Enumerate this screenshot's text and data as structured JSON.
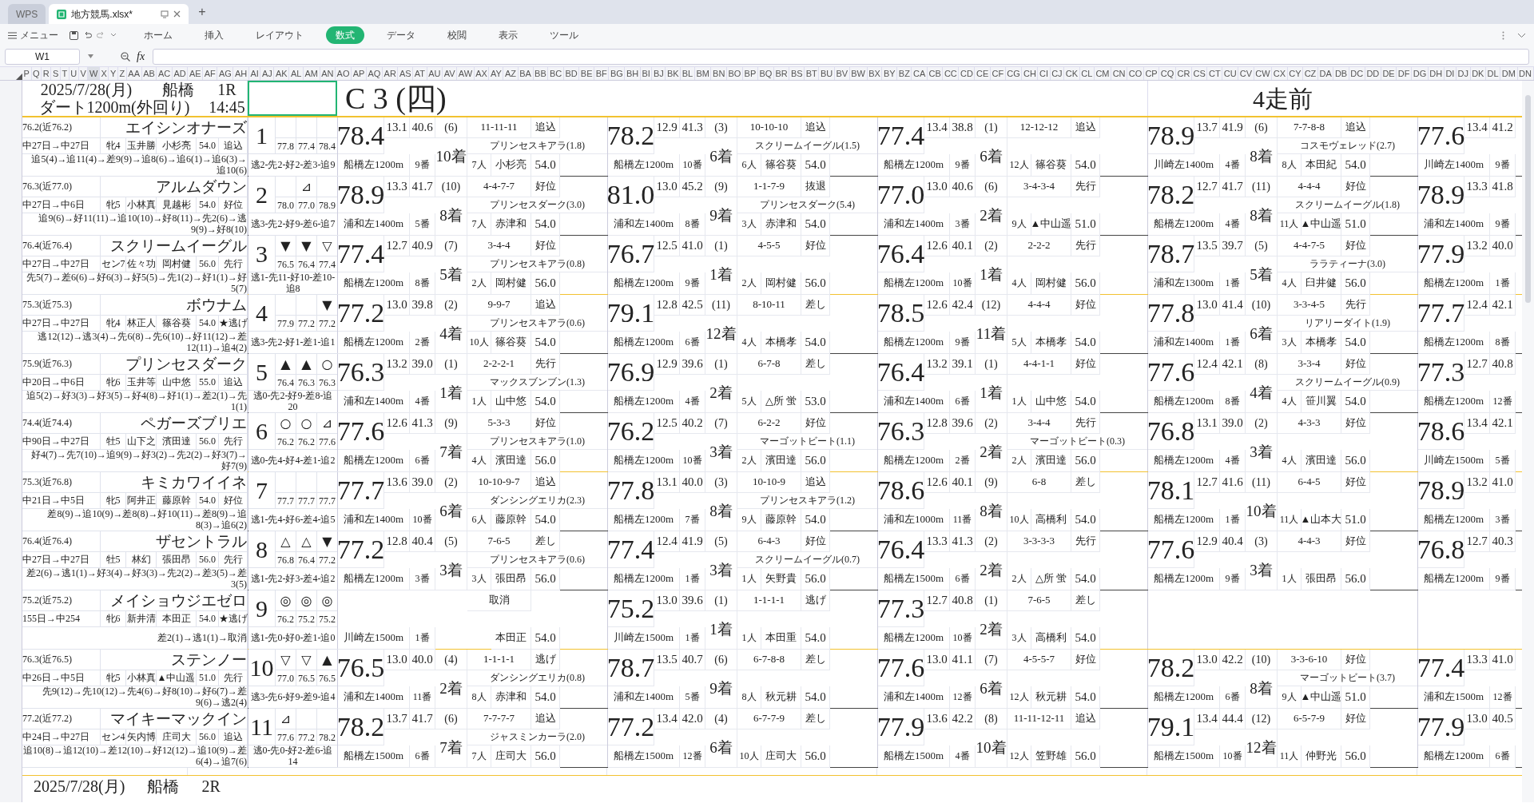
{
  "tabs": [
    {
      "label": "WPS",
      "selected": false
    },
    {
      "label": "地方競馬.xlsx*",
      "selected": true
    }
  ],
  "new_tab": "+",
  "menu": "メニュー",
  "ribbon_tabs": [
    {
      "label": "ホーム",
      "selected": false
    },
    {
      "label": "挿入",
      "selected": false
    },
    {
      "label": "レイアウト",
      "selected": false
    },
    {
      "label": "数式",
      "selected": true
    },
    {
      "label": "データ",
      "selected": false
    },
    {
      "label": "校閲",
      "selected": false
    },
    {
      "label": "表示",
      "selected": false
    },
    {
      "label": "ツール",
      "selected": false
    }
  ],
  "name_box": "W1",
  "formula_label": "fx",
  "columns": [
    "P",
    "Q",
    "R",
    "S",
    "T",
    "U",
    "V",
    "W",
    "X",
    "Y",
    "Z",
    "AA",
    "AB",
    "AC",
    "AD",
    "AE",
    "AF",
    "AG",
    "AH",
    "AI",
    "AJ",
    "AK",
    "AL",
    "AM",
    "AN",
    "AO",
    "AP",
    "AQ",
    "AR",
    "AS",
    "AT",
    "AU",
    "AV",
    "AW",
    "AX",
    "AY",
    "AZ",
    "BA",
    "BB",
    "BC",
    "BD",
    "BE",
    "BF",
    "BG",
    "BH",
    "BI",
    "BJ",
    "BK",
    "BL",
    "BM",
    "BN",
    "BO",
    "BP",
    "BQ",
    "BR",
    "BS",
    "BT",
    "BU",
    "BV",
    "BW",
    "BX",
    "BY",
    "BZ",
    "CA",
    "CB",
    "CC",
    "CD",
    "CE",
    "CF",
    "CG",
    "CH",
    "CI",
    "CJ",
    "CK",
    "CL",
    "CM",
    "CN",
    "CO",
    "CP",
    "CQ",
    "CR",
    "CS",
    "CT",
    "CU",
    "CV",
    "CW",
    "CX",
    "CY",
    "CZ",
    "DA",
    "DB",
    "DC",
    "DD",
    "DE",
    "DF",
    "DG",
    "DH",
    "DI",
    "DJ",
    "DK",
    "DL",
    "DM",
    "DN"
  ],
  "race": {
    "date": "2025/7/28(月)",
    "venue": "船橋",
    "number": "1R",
    "course": "ダート1200m(外回り)",
    "time": "14:45",
    "header_cells": [
      {
        "kind": "class",
        "text": "C 3 (四)"
      },
      {
        "kind": "runs",
        "text": "4走前"
      }
    ]
  },
  "horses": [
    {
      "rating": "76.2(近76.2)",
      "name": "エイシンオナーズ",
      "interval": "中27日→中27日",
      "sex": "牝4",
      "trainer": "玉井勝",
      "jockey": "小杉亮",
      "weight": "54.0",
      "style": "追込",
      "history": "追5(4)→追11(4)→差9(9)→追8(6)→追6(1)→追6(3)→追10(6)",
      "number": "1",
      "marks": [
        {
          "kind": "blank"
        },
        {
          "kind": "blank"
        },
        {
          "kind": "blank"
        }
      ],
      "mark_values": [
        "77.8",
        "77.4",
        "78.4"
      ],
      "style_counts": "逃2-先2-好2-差3-追9",
      "past": [
        {
          "kind": "run",
          "score": "78.4",
          "f3": "13.1",
          "l3": "40.6",
          "pos": "(6)",
          "pass": "11-11-11",
          "style": "追込",
          "winner": "プリンセスキアラ(1.8)",
          "course": "船橋左1200m",
          "gate": "9番",
          "finish": "10着",
          "pop": "7人",
          "jockey": "小杉亮",
          "weight": "54.0"
        },
        {
          "kind": "run",
          "score": "78.2",
          "f3": "12.9",
          "l3": "41.3",
          "pos": "(3)",
          "pass": "10-10-10",
          "style": "追込",
          "winner": "スクリームイーグル(1.5)",
          "course": "船橋左1200m",
          "gate": "10番",
          "finish": "6着",
          "pop": "6人",
          "jockey": "篠谷葵",
          "weight": "54.0"
        },
        {
          "kind": "run",
          "score": "77.4",
          "f3": "13.4",
          "l3": "38.8",
          "pos": "(1)",
          "pass": "12-12-12",
          "style": "追込",
          "course": "船橋左1200m",
          "gate": "9番",
          "finish": "6着",
          "pop": "12人",
          "jockey": "篠谷葵",
          "weight": "54.0"
        },
        {
          "kind": "run",
          "score": "78.9",
          "f3": "13.7",
          "l3": "41.9",
          "pos": "(6)",
          "pass": "7-7-8-8",
          "style": "追込",
          "winner": "コスモヴェレッド(2.7)",
          "course": "川崎左1400m",
          "gate": "4番",
          "finish": "8着",
          "pop": "8人",
          "jockey": "本田紀",
          "weight": "54.0"
        },
        {
          "kind": "run",
          "score": "77.6",
          "f3": "13.4",
          "l3": "41.2",
          "course": "川崎左1400m",
          "gate": "9番"
        }
      ]
    },
    {
      "rating": "76.3(近77.0)",
      "name": "アルムダウン",
      "interval": "中27日→中6日",
      "sex": "牝5",
      "trainer": "小林真",
      "jockey": "見越彬",
      "weight": "54.0",
      "style": "好位",
      "history": "追9(6)→好11(11)→追10(10)→好8(11)→先2(6)→逃9(9)→好8(10)",
      "number": "2",
      "marks": [
        {
          "kind": "blank"
        },
        {
          "kind": "mark",
          "symbol": "⊿"
        },
        {
          "kind": "blank"
        }
      ],
      "mark_values": [
        "78.0",
        "77.0",
        "78.9"
      ],
      "style_counts": "逃3-先2-好9-差6-追7",
      "past": [
        {
          "kind": "run",
          "score": "78.9",
          "f3": "13.3",
          "l3": "41.7",
          "pos": "(10)",
          "pass": "4-4-7-7",
          "style": "好位",
          "winner": "プリンセスダーク(3.0)",
          "course": "浦和左1400m",
          "gate": "5番",
          "finish": "8着",
          "pop": "7人",
          "jockey": "赤津和",
          "weight": "54.0"
        },
        {
          "kind": "run",
          "score": "81.0",
          "f3": "13.0",
          "l3": "45.2",
          "pos": "(9)",
          "pass": "1-1-7-9",
          "style": "抜退",
          "winner": "プリンセスダーク(5.4)",
          "course": "浦和左1400m",
          "gate": "8番",
          "finish": "9着",
          "pop": "3人",
          "jockey": "赤津和",
          "weight": "54.0"
        },
        {
          "kind": "run",
          "score": "77.0",
          "f3": "13.0",
          "l3": "40.6",
          "pos": "(6)",
          "pass": "3-4-3-4",
          "style": "先行",
          "course": "浦和左1400m",
          "gate": "3番",
          "finish": "2着",
          "pop": "9人",
          "jockey": "▲中山遥",
          "weight": "51.0"
        },
        {
          "kind": "run",
          "score": "78.2",
          "f3": "12.7",
          "l3": "41.7",
          "pos": "(11)",
          "pass": "4-4-4",
          "style": "好位",
          "winner": "スクリームイーグル(1.8)",
          "course": "船橋左1200m",
          "gate": "4番",
          "finish": "8着",
          "pop": "11人",
          "jockey": "▲中山遥",
          "weight": "51.0"
        },
        {
          "kind": "run",
          "score": "78.9",
          "f3": "13.3",
          "l3": "41.8",
          "course": "浦和左1400m",
          "gate": "9番"
        }
      ]
    },
    {
      "rating": "76.4(近76.4)",
      "name": "スクリームイーグル",
      "interval": "中27日→中27日",
      "sex": "セン7",
      "trainer": "佐々功",
      "jockey": "岡村健",
      "weight": "56.0",
      "style": "先行",
      "history": "先5(7)→差6(6)→好6(3)→好5(5)→先1(2)→好1(1)→好5(7)",
      "number": "3",
      "marks": [
        {
          "kind": "mark",
          "symbol": "▼"
        },
        {
          "kind": "mark",
          "symbol": "▼"
        },
        {
          "kind": "mark",
          "symbol": "▽"
        }
      ],
      "mark_values": [
        "76.5",
        "76.4",
        "77.4"
      ],
      "style_counts": "逃1-先11-好10-差10-追8",
      "past": [
        {
          "kind": "run",
          "score": "77.4",
          "f3": "12.7",
          "l3": "40.9",
          "pos": "(7)",
          "pass": "3-4-4",
          "style": "好位",
          "winner": "プリンセスキアラ(0.8)",
          "course": "船橋左1200m",
          "gate": "8番",
          "finish": "5着",
          "pop": "2人",
          "jockey": "岡村健",
          "weight": "56.0"
        },
        {
          "kind": "run",
          "score": "76.7",
          "f3": "12.5",
          "l3": "41.0",
          "pos": "(1)",
          "pass": "4-5-5",
          "style": "好位",
          "course": "船橋左1200m",
          "gate": "9番",
          "finish": "1着",
          "pop": "2人",
          "jockey": "岡村健",
          "weight": "56.0"
        },
        {
          "kind": "run",
          "score": "76.4",
          "f3": "12.6",
          "l3": "40.1",
          "pos": "(2)",
          "pass": "2-2-2",
          "style": "先行",
          "course": "船橋左1200m",
          "gate": "10番",
          "finish": "1着",
          "pop": "4人",
          "jockey": "岡村健",
          "weight": "56.0"
        },
        {
          "kind": "run",
          "score": "78.7",
          "f3": "13.5",
          "l3": "39.7",
          "pos": "(5)",
          "pass": "4-4-7-5",
          "style": "好位",
          "winner": "ララティーナ(3.0)",
          "course": "浦和左1300m",
          "gate": "1番",
          "finish": "5着",
          "pop": "4人",
          "jockey": "臼井健",
          "weight": "56.0"
        },
        {
          "kind": "run",
          "score": "77.9",
          "f3": "13.2",
          "l3": "40.0",
          "course": "船橋左1200m",
          "gate": "1番"
        }
      ]
    },
    {
      "rating": "75.3(近75.3)",
      "name": "ボウナム",
      "interval": "中27日→中27日",
      "sex": "牝4",
      "trainer": "林正人",
      "jockey": "篠谷葵",
      "weight": "54.0",
      "style": "★逃げ",
      "history": "逃12(12)→逃3(4)→先6(8)→先6(10)→好11(12)→差12(11)→追4(2)",
      "number": "4",
      "marks": [
        {
          "kind": "blank"
        },
        {
          "kind": "blank"
        },
        {
          "kind": "mark",
          "symbol": "▼"
        }
      ],
      "mark_values": [
        "77.9",
        "77.2",
        "77.2"
      ],
      "style_counts": "逃3-先2-好1-差1-追1",
      "past": [
        {
          "kind": "run",
          "score": "77.2",
          "f3": "13.0",
          "l3": "39.8",
          "pos": "(2)",
          "pass": "9-9-7",
          "style": "追込",
          "winner": "プリンセスキアラ(0.6)",
          "course": "船橋左1200m",
          "gate": "2番",
          "finish": "4着",
          "pop": "10人",
          "jockey": "篠谷葵",
          "weight": "54.0"
        },
        {
          "kind": "run",
          "score": "79.1",
          "f3": "12.8",
          "l3": "42.5",
          "pos": "(11)",
          "pass": "8-10-11",
          "style": "差し",
          "course": "船橋左1200m",
          "gate": "6番",
          "finish": "12着",
          "pop": "4人",
          "jockey": "本橋孝",
          "weight": "54.0"
        },
        {
          "kind": "run",
          "score": "78.5",
          "f3": "12.6",
          "l3": "42.4",
          "pos": "(12)",
          "pass": "4-4-4",
          "style": "好位",
          "course": "船橋左1200m",
          "gate": "9番",
          "finish": "11着",
          "pop": "5人",
          "jockey": "本橋孝",
          "weight": "54.0"
        },
        {
          "kind": "run",
          "score": "77.8",
          "f3": "13.0",
          "l3": "41.4",
          "pos": "(10)",
          "pass": "3-3-4-5",
          "style": "先行",
          "winner": "リアリーダイト(1.9)",
          "course": "浦和左1400m",
          "gate": "1番",
          "finish": "6着",
          "pop": "3人",
          "jockey": "本橋孝",
          "weight": "54.0"
        },
        {
          "kind": "run",
          "score": "77.7",
          "f3": "12.4",
          "l3": "42.1",
          "course": "船橋左1200m",
          "gate": "8番"
        }
      ]
    },
    {
      "rating": "75.9(近76.3)",
      "name": "プリンセスダーク",
      "interval": "中20日→中6日",
      "sex": "牝6",
      "trainer": "玉井等",
      "jockey": "山中悠",
      "weight": "55.0",
      "style": "追込",
      "history": "追5(2)→好3(3)→好3(5)→好4(8)→好1(1)→差2(1)→先1(1)",
      "number": "5",
      "marks": [
        {
          "kind": "mark",
          "symbol": "▲"
        },
        {
          "kind": "mark",
          "symbol": "▲"
        },
        {
          "kind": "mark",
          "symbol": "○"
        }
      ],
      "mark_values": [
        "76.4",
        "76.3",
        "76.3"
      ],
      "style_counts": "逃0-先2-好9-差8-追20",
      "past": [
        {
          "kind": "run",
          "score": "76.3",
          "f3": "13.2",
          "l3": "39.0",
          "pos": "(1)",
          "pass": "2-2-2-1",
          "style": "先行",
          "winner": "マックスブンブン(1.3)",
          "course": "浦和左1400m",
          "gate": "4番",
          "finish": "1着",
          "pop": "1人",
          "jockey": "山中悠",
          "weight": "54.0"
        },
        {
          "kind": "run",
          "score": "76.9",
          "f3": "12.9",
          "l3": "39.6",
          "pos": "(1)",
          "pass": "6-7-8",
          "style": "差し",
          "course": "船橋左1200m",
          "gate": "4番",
          "finish": "2着",
          "pop": "5人",
          "jockey": "△所 蛍",
          "weight": "53.0"
        },
        {
          "kind": "run",
          "score": "76.4",
          "f3": "13.2",
          "l3": "39.1",
          "pos": "(1)",
          "pass": "4-4-1-1",
          "style": "好位",
          "course": "浦和左1400m",
          "gate": "6番",
          "finish": "1着",
          "pop": "1人",
          "jockey": "山中悠",
          "weight": "54.0"
        },
        {
          "kind": "run",
          "score": "77.6",
          "f3": "12.4",
          "l3": "42.1",
          "pos": "(8)",
          "pass": "3-3-4",
          "style": "好位",
          "winner": "スクリームイーグル(0.9)",
          "course": "船橋左1200m",
          "gate": "8番",
          "finish": "4着",
          "pop": "4人",
          "jockey": "笹川翼",
          "weight": "54.0"
        },
        {
          "kind": "run",
          "score": "77.3",
          "f3": "12.7",
          "l3": "40.8",
          "course": "船橋左1200m",
          "gate": "12番"
        }
      ]
    },
    {
      "rating": "74.4(近74.4)",
      "name": "ペガーズブリエ",
      "interval": "中90日→中27日",
      "sex": "牡5",
      "trainer": "山下之",
      "jockey": "濱田達",
      "weight": "56.0",
      "style": "先行",
      "history": "好4(7)→先7(10)→追9(9)→好3(2)→先2(2)→好3(7)→好7(9)",
      "number": "6",
      "marks": [
        {
          "kind": "mark",
          "symbol": "○"
        },
        {
          "kind": "mark",
          "symbol": "○"
        },
        {
          "kind": "mark",
          "symbol": "⊿"
        }
      ],
      "mark_values": [
        "76.2",
        "76.2",
        "77.6"
      ],
      "style_counts": "逃0-先4-好4-差1-追2",
      "past": [
        {
          "kind": "run",
          "score": "77.6",
          "f3": "12.6",
          "l3": "41.3",
          "pos": "(9)",
          "pass": "5-3-3",
          "style": "好位",
          "winner": "プリンセスキアラ(1.0)",
          "course": "船橋左1200m",
          "gate": "6番",
          "finish": "7着",
          "pop": "4人",
          "jockey": "濱田達",
          "weight": "56.0"
        },
        {
          "kind": "run",
          "score": "76.2",
          "f3": "12.5",
          "l3": "40.2",
          "pos": "(7)",
          "pass": "6-2-2",
          "style": "好位",
          "winner": "マーゴットビート(1.1)",
          "course": "船橋左1200m",
          "gate": "10番",
          "finish": "3着",
          "pop": "2人",
          "jockey": "濱田達",
          "weight": "56.0"
        },
        {
          "kind": "run",
          "score": "76.3",
          "f3": "12.8",
          "l3": "39.6",
          "pos": "(2)",
          "pass": "3-4-4",
          "style": "先行",
          "winner": "マーゴットビート(0.3)",
          "course": "船橋左1200m",
          "gate": "2番",
          "finish": "2着",
          "pop": "2人",
          "jockey": "濱田達",
          "weight": "56.0"
        },
        {
          "kind": "run",
          "score": "76.8",
          "f3": "13.1",
          "l3": "39.0",
          "pos": "(2)",
          "pass": "4-3-3",
          "style": "好位",
          "course": "船橋左1200m",
          "gate": "4番",
          "finish": "3着",
          "pop": "4人",
          "jockey": "濱田達",
          "weight": "56.0"
        },
        {
          "kind": "run",
          "score": "78.6",
          "f3": "13.4",
          "l3": "42.1",
          "course": "川崎左1500m",
          "gate": "5番"
        }
      ]
    },
    {
      "rating": "75.3(近76.8)",
      "name": "キミカワイイネ",
      "interval": "中21日→中5日",
      "sex": "牝5",
      "trainer": "阿井正",
      "jockey": "藤原幹",
      "weight": "54.0",
      "style": "好位",
      "history": "差8(9)→追10(9)→差8(8)→好10(11)→差8(9)→追8(3)→追6(2)",
      "number": "7",
      "marks": [
        {
          "kind": "blank"
        },
        {
          "kind": "blank"
        },
        {
          "kind": "blank"
        }
      ],
      "mark_values": [
        "77.7",
        "77.7",
        "77.7"
      ],
      "style_counts": "逃1-先4-好6-差4-追5",
      "past": [
        {
          "kind": "run",
          "score": "77.7",
          "f3": "13.6",
          "l3": "39.0",
          "pos": "(2)",
          "pass": "10-10-9-7",
          "style": "追込",
          "winner": "ダンシングエリカ(2.3)",
          "course": "浦和左1400m",
          "gate": "10番",
          "finish": "6着",
          "pop": "6人",
          "jockey": "藤原幹",
          "weight": "54.0"
        },
        {
          "kind": "run",
          "score": "77.8",
          "f3": "13.1",
          "l3": "40.0",
          "pos": "(3)",
          "pass": "10-10-9",
          "style": "追込",
          "winner": "プリンセスキアラ(1.2)",
          "course": "船橋左1200m",
          "gate": "7番",
          "finish": "8着",
          "pop": "9人",
          "jockey": "藤原幹",
          "weight": "54.0"
        },
        {
          "kind": "run",
          "score": "78.6",
          "f3": "12.6",
          "l3": "40.1",
          "pos": "(9)",
          "pass": "6-8",
          "style": "差し",
          "course": "浦和左1000m",
          "gate": "11番",
          "finish": "8着",
          "pop": "10人",
          "jockey": "高橋利",
          "weight": "54.0"
        },
        {
          "kind": "run",
          "score": "78.1",
          "f3": "12.7",
          "l3": "41.6",
          "pos": "(11)",
          "pass": "6-4-5",
          "style": "好位",
          "course": "船橋左1200m",
          "gate": "1番",
          "finish": "10着",
          "pop": "11人",
          "jockey": "▲山本大",
          "weight": "51.0"
        },
        {
          "kind": "run",
          "score": "78.9",
          "f3": "13.2",
          "l3": "41.0",
          "course": "船橋左1200m",
          "gate": "3番"
        }
      ]
    },
    {
      "rating": "76.4(近76.4)",
      "name": "ザセントラル",
      "interval": "中27日→中27日",
      "sex": "牡5",
      "trainer": "林幻",
      "jockey": "張田昂",
      "weight": "56.0",
      "style": "先行",
      "history": "差2(6)→逃1(1)→好3(4)→好3(3)→先2(2)→差3(5)→差3(5)",
      "number": "8",
      "marks": [
        {
          "kind": "mark",
          "symbol": "△"
        },
        {
          "kind": "mark",
          "symbol": "△"
        },
        {
          "kind": "mark",
          "symbol": "▼"
        }
      ],
      "mark_values": [
        "76.8",
        "76.4",
        "77.2"
      ],
      "style_counts": "逃1-先2-好3-差4-追2",
      "past": [
        {
          "kind": "run",
          "score": "77.2",
          "f3": "12.8",
          "l3": "40.4",
          "pos": "(5)",
          "pass": "7-6-5",
          "style": "差し",
          "winner": "プリンセスキアラ(0.6)",
          "course": "船橋左1200m",
          "gate": "3番",
          "finish": "3着",
          "pop": "3人",
          "jockey": "張田昂",
          "weight": "56.0"
        },
        {
          "kind": "run",
          "score": "77.4",
          "f3": "12.4",
          "l3": "41.9",
          "pos": "(5)",
          "pass": "6-4-3",
          "style": "好位",
          "winner": "スクリームイーグル(0.7)",
          "course": "船橋左1200m",
          "gate": "1番",
          "finish": "3着",
          "pop": "1人",
          "jockey": "矢野貴",
          "weight": "56.0"
        },
        {
          "kind": "run",
          "score": "76.4",
          "f3": "13.3",
          "l3": "41.3",
          "pos": "(2)",
          "pass": "3-3-3-3",
          "style": "先行",
          "course": "船橋左1500m",
          "gate": "6番",
          "finish": "2着",
          "pop": "2人",
          "jockey": "△所 蛍",
          "weight": "54.0"
        },
        {
          "kind": "run",
          "score": "77.6",
          "f3": "12.9",
          "l3": "40.4",
          "pos": "(3)",
          "pass": "4-4-3",
          "style": "好位",
          "course": "船橋左1200m",
          "gate": "9番",
          "finish": "3着",
          "pop": "1人",
          "jockey": "張田昂",
          "weight": "56.0"
        },
        {
          "kind": "run",
          "score": "76.8",
          "f3": "12.7",
          "l3": "40.3",
          "course": "船橋左1200m",
          "gate": "9番"
        }
      ]
    },
    {
      "rating": "75.2(近75.2)",
      "name": "メイショウジエゼロ",
      "interval": "155日→中254",
      "sex": "牝6",
      "trainer": "新井清",
      "jockey": "本田正",
      "weight": "54.0",
      "style": "★逃げ",
      "history": "差2(1)→逃1(1)→取消",
      "number": "9",
      "marks": [
        {
          "kind": "mark",
          "symbol": "◎"
        },
        {
          "kind": "mark",
          "symbol": "◎"
        },
        {
          "kind": "mark",
          "symbol": "◎"
        }
      ],
      "mark_values": [
        "76.2",
        "75.2",
        "75.2"
      ],
      "style_counts": "逃1-先0-好0-差1-追0",
      "past": [
        {
          "kind": "cancelled",
          "pass": "取消",
          "course": "川崎左1500m",
          "gate": "1番",
          "jockey": "本田正",
          "weight": "54.0"
        },
        {
          "kind": "run",
          "score": "75.2",
          "f3": "13.0",
          "l3": "39.6",
          "pos": "(1)",
          "pass": "1-1-1-1",
          "style": "逃げ",
          "course": "川崎左1500m",
          "gate": "1番",
          "finish": "1着",
          "pop": "1人",
          "jockey": "本田重",
          "weight": "54.0"
        },
        {
          "kind": "run",
          "score": "77.3",
          "f3": "12.7",
          "l3": "40.8",
          "pos": "(1)",
          "pass": "7-6-5",
          "style": "差し",
          "course": "船橋左1200m",
          "gate": "10番",
          "finish": "2着",
          "pop": "3人",
          "jockey": "高橋利",
          "weight": "54.0"
        }
      ]
    },
    {
      "rating": "76.3(近76.5)",
      "name": "ステンノー",
      "interval": "中26日→中5日",
      "sex": "牝5",
      "trainer": "小林真",
      "jockey": "▲中山遥",
      "weight": "51.0",
      "style": "先行",
      "history": "先9(12)→先10(12)→先4(6)→好8(10)→好6(7)→差9(6)→逃2(4)",
      "number": "10",
      "marks": [
        {
          "kind": "mark",
          "symbol": "▽"
        },
        {
          "kind": "mark",
          "symbol": "▽"
        },
        {
          "kind": "mark",
          "symbol": "▲"
        }
      ],
      "mark_values": [
        "77.0",
        "76.5",
        "76.5"
      ],
      "style_counts": "逃3-先6-好9-差9-追4",
      "past": [
        {
          "kind": "run",
          "score": "76.5",
          "f3": "13.0",
          "l3": "40.0",
          "pos": "(4)",
          "pass": "1-1-1-1",
          "style": "逃げ",
          "winner": "ダンシングエリカ(0.8)",
          "course": "浦和左1400m",
          "gate": "11番",
          "finish": "2着",
          "pop": "8人",
          "jockey": "赤津和",
          "weight": "54.0"
        },
        {
          "kind": "run",
          "score": "78.7",
          "f3": "13.5",
          "l3": "40.7",
          "pos": "(6)",
          "pass": "6-7-8-8",
          "style": "差し",
          "course": "浦和左1400m",
          "gate": "5番",
          "finish": "9着",
          "pop": "8人",
          "jockey": "秋元耕",
          "weight": "54.0"
        },
        {
          "kind": "run",
          "score": "77.6",
          "f3": "13.0",
          "l3": "41.1",
          "pos": "(7)",
          "pass": "4-5-5-7",
          "style": "好位",
          "course": "浦和左1400m",
          "gate": "12番",
          "finish": "6着",
          "pop": "12人",
          "jockey": "秋元耕",
          "weight": "54.0"
        },
        {
          "kind": "run",
          "score": "78.2",
          "f3": "13.0",
          "l3": "42.2",
          "pos": "(10)",
          "pass": "3-3-6-10",
          "style": "好位",
          "winner": "マーゴットビート(3.7)",
          "course": "船橋左1200m",
          "gate": "6番",
          "finish": "8着",
          "pop": "9人",
          "jockey": "▲中山遥",
          "weight": "51.0"
        },
        {
          "kind": "run",
          "score": "77.4",
          "f3": "13.3",
          "l3": "41.0",
          "course": "浦和左1500m",
          "gate": "12番"
        }
      ]
    },
    {
      "rating": "77.2(近77.2)",
      "name": "マイキーマックイン",
      "interval": "中24日→中27日",
      "sex": "セン4",
      "trainer": "矢内博",
      "jockey": "庄司大",
      "weight": "56.0",
      "style": "追込",
      "history": "追10(8)→追12(10)→差12(10)→好12(12)→追10(9)→差6(4)→追7(6)",
      "number": "11",
      "marks": [
        {
          "kind": "mark",
          "symbol": "⊿"
        },
        {
          "kind": "blank"
        },
        {
          "kind": "blank"
        }
      ],
      "mark_values": [
        "77.6",
        "77.2",
        "78.2"
      ],
      "style_counts": "逃0-先0-好2-差6-追14",
      "past": [
        {
          "kind": "run",
          "score": "78.2",
          "f3": "13.7",
          "l3": "41.7",
          "pos": "(6)",
          "pass": "7-7-7-7",
          "style": "追込",
          "winner": "ジャスミンカーラ(2.0)",
          "course": "船橋左1500m",
          "gate": "6番",
          "finish": "7着",
          "pop": "7人",
          "jockey": "庄司大",
          "weight": "56.0"
        },
        {
          "kind": "run",
          "score": "77.2",
          "f3": "13.4",
          "l3": "42.0",
          "pos": "(4)",
          "pass": "6-7-7-9",
          "style": "差し",
          "course": "船橋左1500m",
          "gate": "12番",
          "finish": "6着",
          "pop": "10人",
          "jockey": "庄司大",
          "weight": "56.0"
        },
        {
          "kind": "run",
          "score": "77.9",
          "f3": "13.6",
          "l3": "42.2",
          "pos": "(8)",
          "pass": "11-11-12-11",
          "style": "追込",
          "course": "船橋左1500m",
          "gate": "4番",
          "finish": "10着",
          "pop": "12人",
          "jockey": "笠野雄",
          "weight": "56.0"
        },
        {
          "kind": "run",
          "score": "79.1",
          "f3": "13.4",
          "l3": "44.4",
          "pos": "(12)",
          "pass": "6-5-7-9",
          "style": "好位",
          "course": "船橋左1500m",
          "gate": "10番",
          "finish": "12着",
          "pop": "11人",
          "jockey": "仲野光",
          "weight": "56.0"
        },
        {
          "kind": "run",
          "score": "77.9",
          "f3": "13.0",
          "l3": "40.5",
          "course": "船橋左1200m",
          "gate": "6番"
        }
      ]
    }
  ],
  "race2": {
    "date": "2025/7/28(月)",
    "venue": "船橋",
    "number": "2R"
  }
}
